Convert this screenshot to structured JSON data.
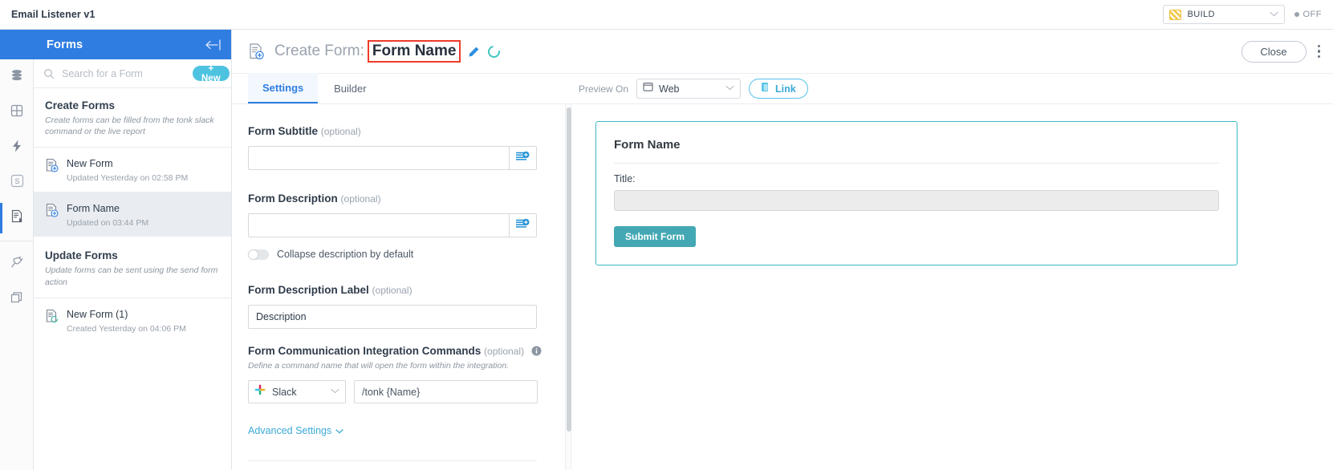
{
  "topbar": {
    "app_title": "Email Listener v1",
    "env_label": "BUILD",
    "status_label": "OFF"
  },
  "rail": {
    "items": [
      {
        "name": "data-icon"
      },
      {
        "name": "tables-icon"
      },
      {
        "name": "actions-icon"
      },
      {
        "name": "scripts-icon",
        "letter": "S"
      },
      {
        "name": "forms-icon"
      },
      {
        "name": "integrations-icon"
      },
      {
        "name": "layers-icon"
      }
    ]
  },
  "forms_panel": {
    "header_title": "Forms",
    "search_placeholder": "Search for a Form",
    "new_button": "+ New",
    "sections": [
      {
        "title": "Create Forms",
        "description": "Create forms can be filled from the tonk slack command or the live report",
        "items": [
          {
            "name": "New Form",
            "meta": "Updated Yesterday on 02:58 PM",
            "selected": false
          },
          {
            "name": "Form Name",
            "meta": "Updated on 03:44 PM",
            "selected": true
          }
        ]
      },
      {
        "title": "Update Forms",
        "description": "Update forms can be sent using the send form action",
        "items": [
          {
            "name": "New Form (1)",
            "meta": "Created Yesterday on 04:06 PM",
            "selected": false
          }
        ]
      }
    ]
  },
  "main": {
    "header": {
      "prefix": "Create Form:",
      "form_name": "Form Name",
      "close_button": "Close"
    },
    "tabs": [
      {
        "label": "Settings",
        "active": true
      },
      {
        "label": "Builder",
        "active": false
      }
    ],
    "preview_on": {
      "label": "Preview On",
      "platform": "Web",
      "link_button": "Link"
    },
    "settings": {
      "form_subtitle": {
        "label": "Form Subtitle",
        "optional": "(optional)",
        "value": "",
        "placeholder": ""
      },
      "form_description": {
        "label": "Form Description",
        "optional": "(optional)",
        "value": "",
        "placeholder": ""
      },
      "collapse_toggle": {
        "label": "Collapse description by default",
        "state": "off"
      },
      "form_description_label": {
        "label": "Form Description Label",
        "optional": "(optional)",
        "value": "Description"
      },
      "integration_commands": {
        "label": "Form Communication Integration Commands",
        "optional": "(optional)",
        "hint": "Define a command name that will open the form within the integration.",
        "integration": "Slack",
        "command": "/tonk {Name}"
      },
      "advanced_settings": "Advanced Settings"
    },
    "preview": {
      "title": "Form Name",
      "field_label": "Title:",
      "field_value": "",
      "submit_button": "Submit Form"
    }
  },
  "colors": {
    "brand_blue": "#2f7de1",
    "accent_cyan": "#4ec3e0",
    "teal": "#43a8b4",
    "annotation_red": "#ee3b2a"
  }
}
